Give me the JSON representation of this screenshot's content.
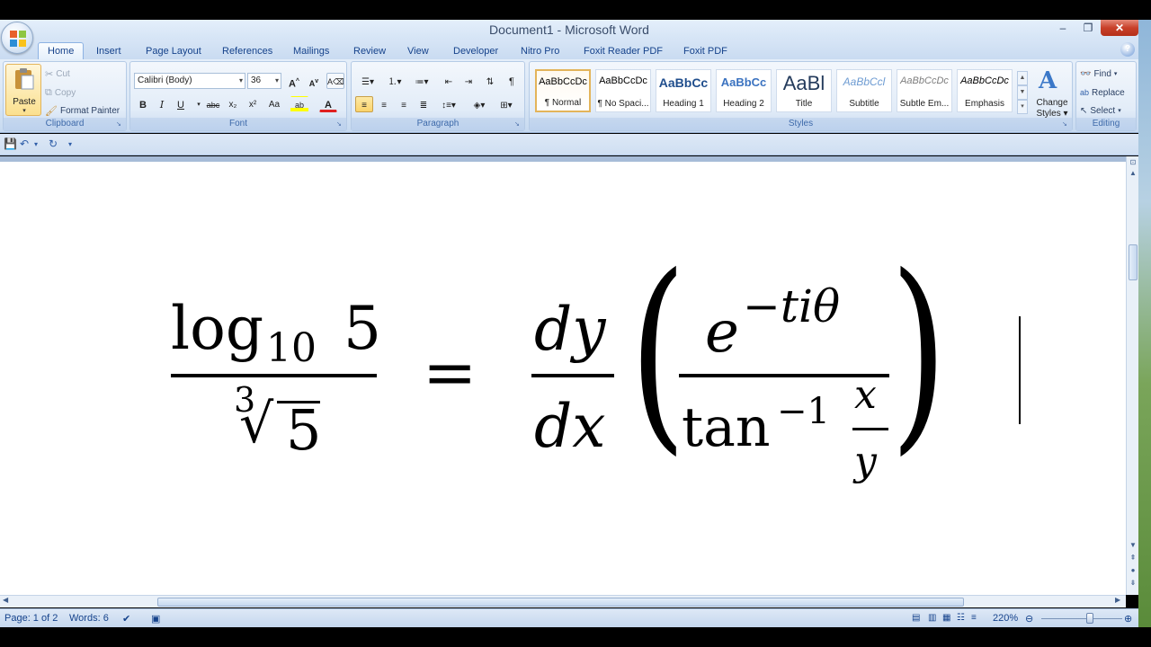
{
  "window": {
    "title": "Document1 - Microsoft Word",
    "minimize": "–",
    "restore": "❐",
    "close": "✕"
  },
  "tabs": [
    "Home",
    "Insert",
    "Page Layout",
    "References",
    "Mailings",
    "Review",
    "View",
    "Developer",
    "Nitro Pro",
    "Foxit Reader PDF",
    "Foxit PDF"
  ],
  "help": "?",
  "clipboard": {
    "label": "Clipboard",
    "paste": "Paste",
    "cut": "Cut",
    "copy": "Copy",
    "format_painter": "Format Painter"
  },
  "font": {
    "label": "Font",
    "font_name": "Calibri (Body)",
    "font_size": "36",
    "grow": "A",
    "shrink": "A",
    "bold": "B",
    "italic": "I",
    "underline": "U",
    "strike": "abc",
    "subscript": "x₂",
    "superscript": "x²",
    "change_case": "Aa",
    "highlight": "ab",
    "font_color": "A"
  },
  "paragraph": {
    "label": "Paragraph",
    "show_marks": "¶"
  },
  "styles": {
    "label": "Styles",
    "items": [
      {
        "preview": "AaBbCcDc",
        "name": "¶ Normal"
      },
      {
        "preview": "AaBbCcDc",
        "name": "¶ No Spaci..."
      },
      {
        "preview": "AaBbCc",
        "name": "Heading 1"
      },
      {
        "preview": "AaBbCc",
        "name": "Heading 2"
      },
      {
        "preview": "AaBl",
        "name": "Title"
      },
      {
        "preview": "AaBbCcl",
        "name": "Subtitle"
      },
      {
        "preview": "AaBbCcDc",
        "name": "Subtle Em..."
      },
      {
        "preview": "AaBbCcDc",
        "name": "Emphasis"
      }
    ],
    "change_styles_1": "Change",
    "change_styles_2": "Styles"
  },
  "editing": {
    "label": "Editing",
    "find": "Find",
    "replace": "Replace",
    "select": "Select"
  },
  "equation": {
    "left_num_log": "log",
    "left_num_sub": "10",
    "left_num_arg": "5",
    "left_den_index": "3",
    "left_den_rad": "√",
    "left_den_val": "5",
    "equals": "=",
    "dy": "dy",
    "dx": "dx",
    "lparen": "(",
    "rparen": ")",
    "e": "e",
    "exp": "−tiθ",
    "tan": "tan",
    "tan_exp": "−1",
    "x": "x",
    "y": "y"
  },
  "status": {
    "page": "Page: 1 of 2",
    "words": "Words: 6",
    "zoom": "220%"
  }
}
